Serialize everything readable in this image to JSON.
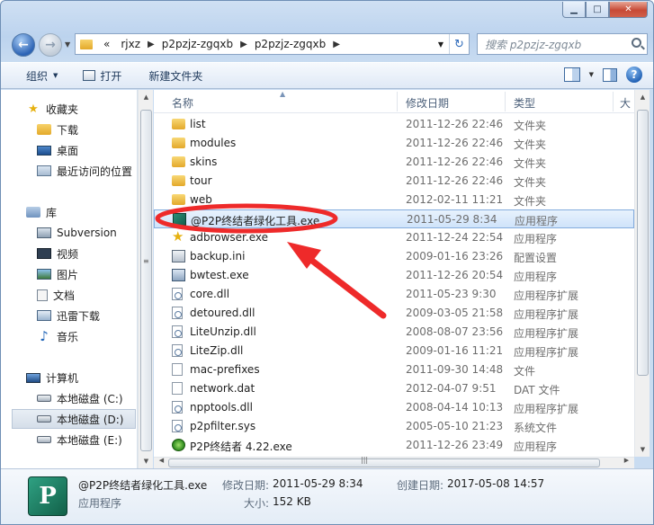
{
  "window": {
    "minimize_glyph": "▁",
    "maximize_glyph": "□",
    "close_glyph": "✕"
  },
  "address": {
    "crumbs": [
      "«",
      "rjxz",
      "p2pzjz-zgqxb",
      "p2pzjz-zgqxb"
    ],
    "refresh_glyph": "↻"
  },
  "search": {
    "placeholder": "搜索 p2pzjz-zgqxb"
  },
  "toolbar": {
    "organize": "组织",
    "open": "打开",
    "new_folder": "新建文件夹",
    "help": "?"
  },
  "navpane": {
    "items": [
      {
        "label": "收藏夹",
        "icon": "star-icon"
      },
      {
        "label": "下载",
        "icon": "folder-icon"
      },
      {
        "label": "桌面",
        "icon": "desktop-icon"
      },
      {
        "label": "最近访问的位置",
        "icon": "recent-places-icon"
      },
      {
        "label": "库",
        "icon": "library-icon"
      },
      {
        "label": "Subversion",
        "icon": "subversion-icon"
      },
      {
        "label": "视频",
        "icon": "video-icon"
      },
      {
        "label": "图片",
        "icon": "picture-icon"
      },
      {
        "label": "文档",
        "icon": "document-icon"
      },
      {
        "label": "迅雷下载",
        "icon": "download-icon"
      },
      {
        "label": "音乐",
        "icon": "music-icon"
      },
      {
        "label": "计算机",
        "icon": "computer-icon"
      },
      {
        "label": "本地磁盘 (C:)",
        "icon": "drive-icon"
      },
      {
        "label": "本地磁盘 (D:)",
        "icon": "drive-icon",
        "selected": true
      },
      {
        "label": "本地磁盘 (E:)",
        "icon": "drive-icon"
      }
    ]
  },
  "columns": {
    "name": "名称",
    "modified": "修改日期",
    "type": "类型",
    "size": "大"
  },
  "files": [
    {
      "name": "list",
      "modified": "2011-12-26 22:46",
      "type": "文件夹",
      "icon": "folder"
    },
    {
      "name": "modules",
      "modified": "2011-12-26 22:46",
      "type": "文件夹",
      "icon": "folder"
    },
    {
      "name": "skins",
      "modified": "2011-12-26 22:46",
      "type": "文件夹",
      "icon": "folder"
    },
    {
      "name": "tour",
      "modified": "2011-12-26 22:46",
      "type": "文件夹",
      "icon": "folder"
    },
    {
      "name": "web",
      "modified": "2012-02-11 11:21",
      "type": "文件夹",
      "icon": "folder"
    },
    {
      "name": "@P2P终结者绿化工具.exe",
      "modified": "2011-05-29 8:34",
      "type": "应用程序",
      "icon": "p2p-exe",
      "selected": true
    },
    {
      "name": "adbrowser.exe",
      "modified": "2011-12-24 22:54",
      "type": "应用程序",
      "icon": "star"
    },
    {
      "name": "backup.ini",
      "modified": "2009-01-16 23:26",
      "type": "配置设置",
      "icon": "ini"
    },
    {
      "name": "bwtest.exe",
      "modified": "2011-12-26 20:54",
      "type": "应用程序",
      "icon": "exe"
    },
    {
      "name": "core.dll",
      "modified": "2011-05-23 9:30",
      "type": "应用程序扩展",
      "icon": "dll"
    },
    {
      "name": "detoured.dll",
      "modified": "2009-03-05 21:58",
      "type": "应用程序扩展",
      "icon": "dll"
    },
    {
      "name": "LiteUnzip.dll",
      "modified": "2008-08-07 23:56",
      "type": "应用程序扩展",
      "icon": "dll"
    },
    {
      "name": "LiteZip.dll",
      "modified": "2009-01-16 11:21",
      "type": "应用程序扩展",
      "icon": "dll"
    },
    {
      "name": "mac-prefixes",
      "modified": "2011-09-30 14:48",
      "type": "文件",
      "icon": "blank"
    },
    {
      "name": "network.dat",
      "modified": "2012-04-07 9:51",
      "type": "DAT 文件",
      "icon": "dat"
    },
    {
      "name": "npptools.dll",
      "modified": "2008-04-14 10:13",
      "type": "应用程序扩展",
      "icon": "dll"
    },
    {
      "name": "p2pfilter.sys",
      "modified": "2005-05-10 21:23",
      "type": "系统文件",
      "icon": "dll"
    },
    {
      "name": "P2P终结者 4.22.exe",
      "modified": "2011-12-26 23:49",
      "type": "应用程序",
      "icon": "green"
    }
  ],
  "details": {
    "filename": "@P2P终结者绿化工具.exe",
    "filetype": "应用程序",
    "modified_label": "修改日期:",
    "modified_value": "2011-05-29 8:34",
    "created_label": "创建日期:",
    "created_value": "2017-05-08 14:57",
    "size_label": "大小:",
    "size_value": "152 KB",
    "icon_letter": "P"
  },
  "colors": {
    "annotation": "#ee2a2a",
    "selection": "#cfe3fa"
  }
}
